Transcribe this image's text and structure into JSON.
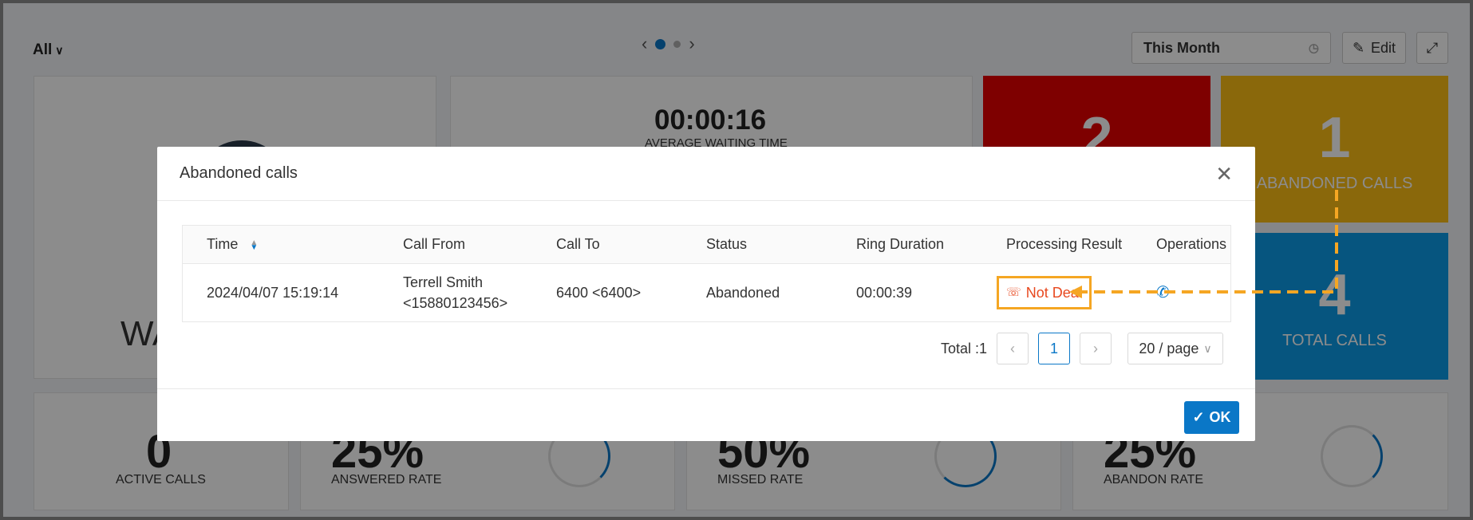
{
  "dashboard": {
    "filter_label": "All",
    "period_label": "This Month",
    "edit_label": "Edit",
    "avg_waiting_time": "00:00:16",
    "avg_waiting_label": "AVERAGE WAITING TIME",
    "waiting_label": "WA",
    "tiles": [
      {
        "value": "2",
        "label": "",
        "color": "#e60000"
      },
      {
        "value": "1",
        "label": "ABANDONED CALLS",
        "color": "#fcbd15"
      },
      {
        "value": "4",
        "label": "TOTAL CALLS",
        "color": "#0c9ce8"
      }
    ],
    "stats": [
      {
        "value": "0",
        "label": "ACTIVE CALLS"
      },
      {
        "value": "25%",
        "label": "ANSWERED RATE"
      },
      {
        "value": "50%",
        "label": "MISSED RATE"
      },
      {
        "value": "25%",
        "label": "ABANDON RATE"
      }
    ]
  },
  "modal": {
    "title": "Abandoned calls",
    "columns": [
      "Time",
      "Call From",
      "Call To",
      "Status",
      "Ring Duration",
      "Processing Result",
      "Operations"
    ],
    "rows": [
      {
        "time": "2024/04/07 15:19:14",
        "from_name": "Terrell Smith",
        "from_number": "<15880123456>",
        "to": "6400 <6400>",
        "status": "Abandoned",
        "ring_duration": "00:00:39",
        "result": "Not Deal"
      }
    ],
    "pagination": {
      "total_label": "Total :1",
      "current_page": "1",
      "page_size": "20 / page"
    },
    "ok_label": "OK"
  },
  "colors": {
    "accent": "#0a77c7",
    "highlight": "#f5a623",
    "result_text": "#e8481f"
  }
}
